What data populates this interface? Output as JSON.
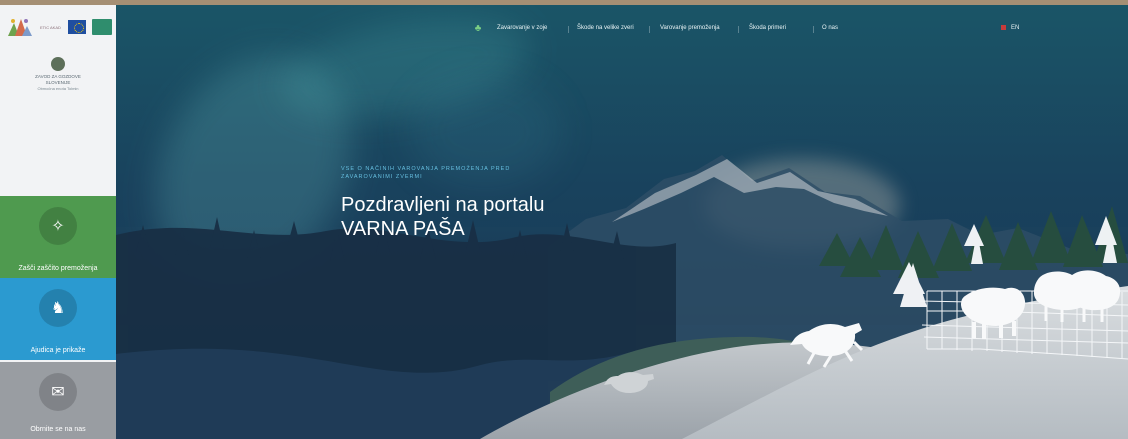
{
  "sidebar": {
    "logo_text": "ETIC AKAD",
    "institution_name": "ZAVOD ZA GOZDOVE SLOVENIJE",
    "institution_sub": "Območna enota Tolmin",
    "tiles": [
      {
        "label": "Zašči zaščito premoženja",
        "color": "#4f9a4f",
        "icon": "security-plant-icon"
      },
      {
        "label": "Ajudica je prikaže",
        "color": "#2b9ad0",
        "icon": "wild-animal-icon"
      },
      {
        "label": "Obrnite se na nas",
        "color": "#999da2",
        "icon": "chat-icon"
      }
    ]
  },
  "nav": {
    "home_icon": "leaf-icon",
    "items": [
      "Zavarovanje v zoje",
      "Škode na velike zveri",
      "Varovanje premoženja",
      "Škoda primeri",
      "O nas"
    ],
    "language": "EN"
  },
  "hero": {
    "eyebrow": "VSE O NAČINIH VAROVANJA PREMOŽENJA PRED ZAVAROVANIMI ZVERMI",
    "title_line1": "Pozdravljeni na portalu",
    "title_line2": "VARNA PAŠA"
  },
  "colors": {
    "sidebar": "#f2f3f5",
    "green_tile": "#4f9a4f",
    "blue_tile": "#2b9ad0",
    "gray_tile": "#999da2",
    "hero_dark": "#16324e",
    "accent": "#66bfe0"
  }
}
